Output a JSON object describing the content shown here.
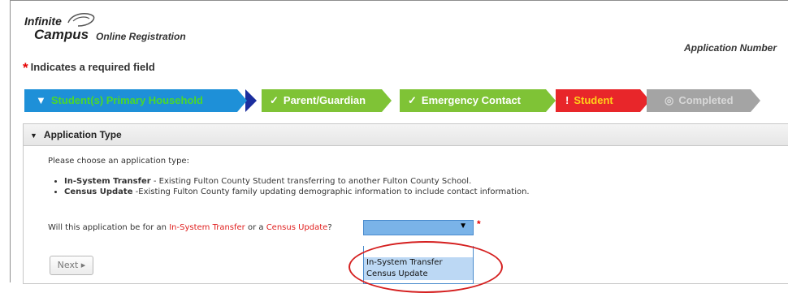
{
  "header": {
    "logo_line1": "Infinite",
    "logo_line2": "Campus",
    "product": "Online Registration",
    "application_number_label": "Application Number"
  },
  "required_note": {
    "star": "*",
    "text": "Indicates a required field"
  },
  "steps": [
    {
      "label": "Student(s) Primary Household",
      "icon": "triangle-down-icon",
      "status": "current",
      "color": "#1e90d8"
    },
    {
      "label": "Parent/Guardian",
      "icon": "check-icon",
      "status": "complete",
      "color": "#7fc336"
    },
    {
      "label": "Emergency Contact",
      "icon": "check-icon",
      "status": "complete",
      "color": "#7fc336"
    },
    {
      "label": "Student",
      "icon": "exclamation-icon",
      "status": "error",
      "color": "#e8262a"
    },
    {
      "label": "Completed",
      "icon": "circle-check-icon",
      "status": "pending",
      "color": "#a4a4a4"
    }
  ],
  "section": {
    "title": "Application Type",
    "prompt": "Please choose an application type:",
    "options_desc": [
      {
        "name": "In-System Transfer",
        "desc": " - Existing Fulton County Student transferring to another Fulton County School."
      },
      {
        "name": "Census Update",
        "desc": " -Existing Fulton County family updating demographic information to include contact information."
      }
    ],
    "question_prefix": "Will this application be for an ",
    "question_opt1": "In-System Transfer",
    "question_mid": " or a ",
    "question_opt2": "Census Update",
    "question_suffix": "?",
    "select": {
      "value": "",
      "required_star": "*",
      "options": [
        "In-System Transfer",
        "Census Update"
      ]
    },
    "next_label": "Next ▸"
  },
  "colors": {
    "accent_blue": "#1e90d8",
    "success_green": "#7fc336",
    "error_red": "#e8262a",
    "pending_gray": "#a4a4a4",
    "highlight_red": "#d52020"
  }
}
